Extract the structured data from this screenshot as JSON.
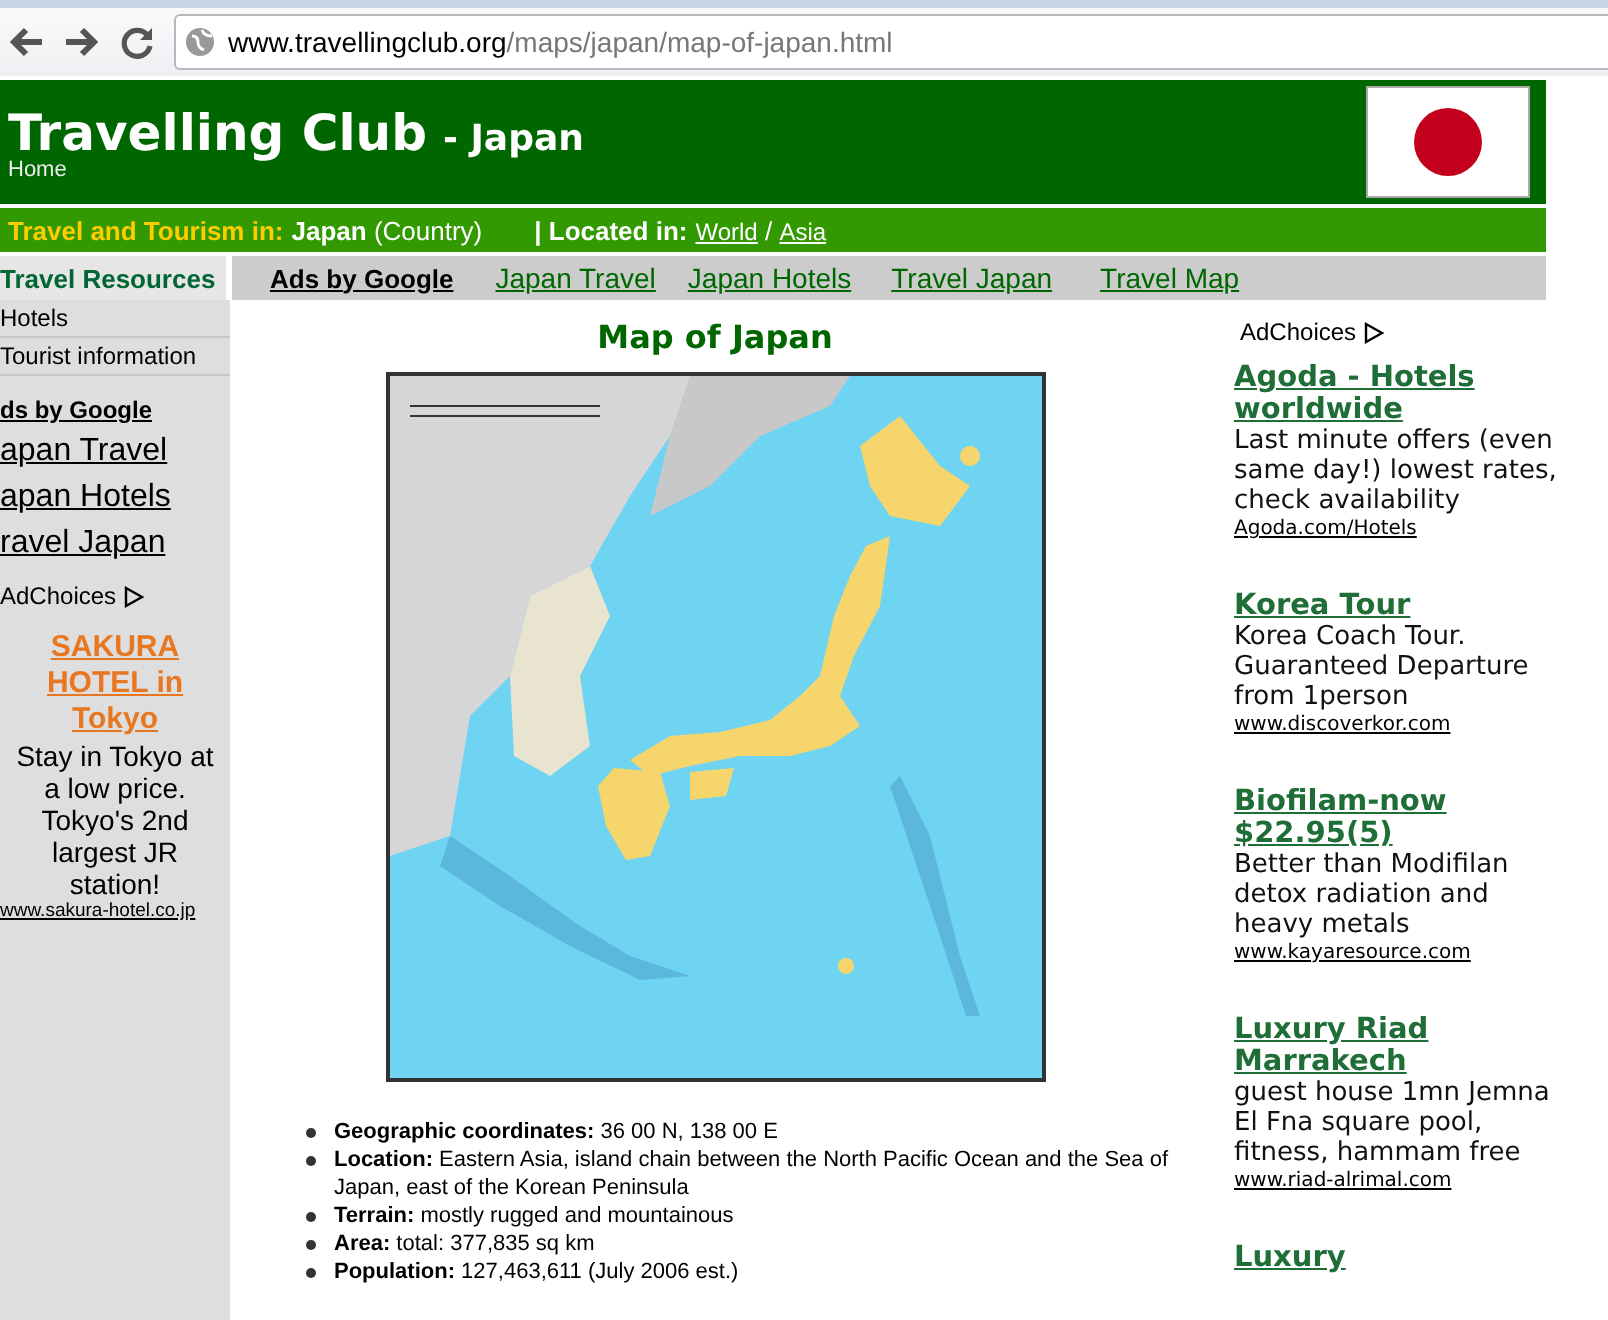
{
  "browser": {
    "url_host": "www.travellingclub.org",
    "url_path": "/maps/japan/map-of-japan.html"
  },
  "header": {
    "title": "Travelling Club",
    "subtitle": "- Japan",
    "home": "Home"
  },
  "location_bar": {
    "label": "Travel and Tourism in:",
    "country": "Japan",
    "country_type": "(Country)",
    "located_label": "| Located in:",
    "links": [
      "World",
      "Asia"
    ],
    "separator": "/"
  },
  "nav": {
    "sidebar_heading": "Travel Resources",
    "ads_label": "Ads by Google",
    "links": [
      "Japan Travel",
      "Japan Hotels",
      "Travel Japan",
      "Travel Map"
    ]
  },
  "sidebar": {
    "items": [
      "Hotels",
      "Tourist information"
    ],
    "ads_label": "ds by Google",
    "ad_links": [
      "apan Travel",
      "apan Hotels",
      "ravel Japan"
    ],
    "adchoices": "AdChoices",
    "ad": {
      "title": "SAKURA HOTEL in Tokyo",
      "text": "Stay in Tokyo at a low price. Tokyo's 2nd largest JR station!",
      "url": "www.sakura-hotel.co.jp"
    }
  },
  "main": {
    "title": "Map of Japan",
    "facts": [
      "**Geographic coordinates:** 36 00 N, 138 00 E",
      "**Location:** Eastern Asia, island chain between the North Pacific Ocean and the Sea of Japan, east of the Korean Peninsula",
      "**Terrain:** mostly rugged and mountainous",
      "**Area:** total: 377,835 sq km",
      "**Population:** 127,463,611 (July 2006 est.)"
    ]
  },
  "right_ads": {
    "adchoices": "AdChoices",
    "ads": [
      {
        "title": "Agoda - Hotels worldwide",
        "text": "Last minute offers (even same day!) lowest rates, check availability",
        "url": "Agoda.com/Hotels"
      },
      {
        "title": "Korea Tour",
        "text": "Korea Coach Tour. Guaranteed Departure from 1person",
        "url": "www.discoverkor.com"
      },
      {
        "title": "Biofilam-now $22.95(5)",
        "text": "Better than Modifilan detox radiation and heavy metals",
        "url": "www.kayaresource.com"
      },
      {
        "title": "Luxury Riad Marrakech",
        "text": "guest house 1mn Jemna El Fna square pool, fitness, hammam free",
        "url": "www.riad-alrimal.com"
      },
      {
        "title": "Luxury"
      }
    ]
  }
}
